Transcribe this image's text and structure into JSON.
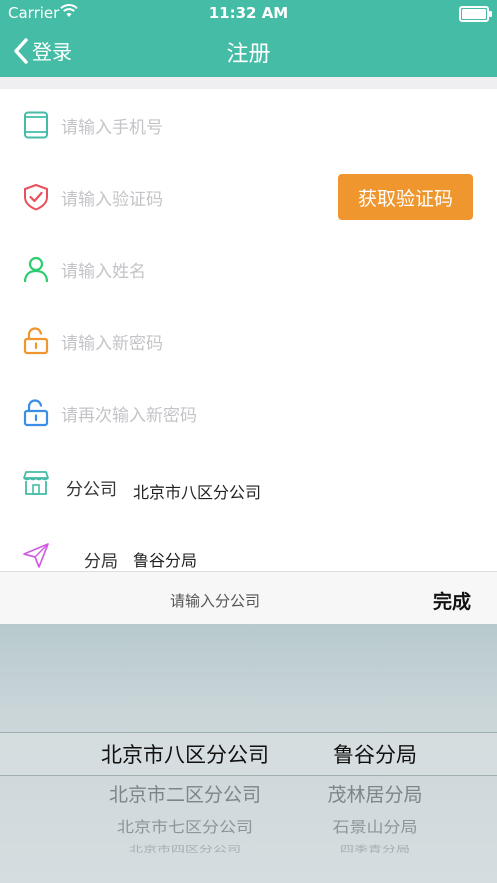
{
  "status_bar": {
    "carrier": "Carrier",
    "time": "11:32 AM"
  },
  "nav": {
    "back_label": "登录",
    "title": "注册"
  },
  "form": {
    "phone_placeholder": "请输入手机号",
    "code_placeholder": "请输入验证码",
    "get_code_label": "获取验证码",
    "name_placeholder": "请输入姓名",
    "password_placeholder": "请输入新密码",
    "confirm_password_placeholder": "请再次输入新密码",
    "branch_label": "分公司",
    "branch_value": "北京市八区分公司",
    "office_label": "分局",
    "office_value": "鲁谷分局"
  },
  "picker_toolbar": {
    "title": "请输入分公司",
    "done_label": "完成"
  },
  "picker": {
    "branches": [
      "北京市八区分公司",
      "北京市二区分公司",
      "北京市七区分公司",
      "北京市四区分公司"
    ],
    "offices": [
      "鲁谷分局",
      "茂林居分局",
      "石景山分局",
      "四季青分局"
    ]
  },
  "colors": {
    "accent": "#45BDA6",
    "button": "#F0962E",
    "phone_icon": "#45BDA6",
    "shield_icon": "#E8505B",
    "person_icon": "#2ECC71",
    "lock_orange": "#F0962E",
    "lock_blue": "#3A8EE6",
    "plane_icon": "#D05CE3"
  }
}
